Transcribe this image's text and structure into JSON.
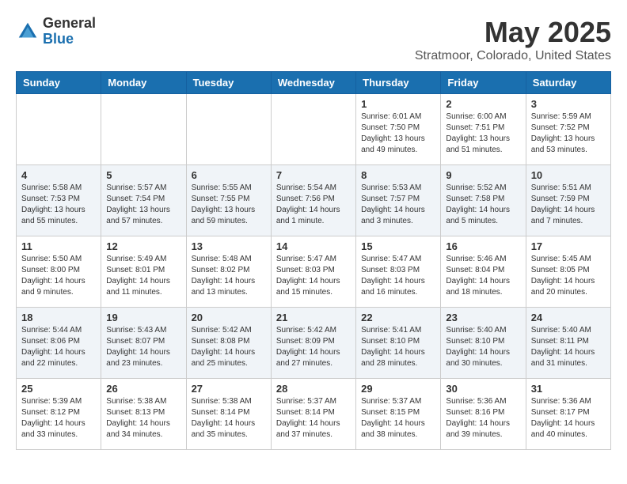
{
  "header": {
    "logo_general": "General",
    "logo_blue": "Blue",
    "month_title": "May 2025",
    "location": "Stratmoor, Colorado, United States"
  },
  "weekdays": [
    "Sunday",
    "Monday",
    "Tuesday",
    "Wednesday",
    "Thursday",
    "Friday",
    "Saturday"
  ],
  "weeks": [
    [
      {
        "day": "",
        "info": ""
      },
      {
        "day": "",
        "info": ""
      },
      {
        "day": "",
        "info": ""
      },
      {
        "day": "",
        "info": ""
      },
      {
        "day": "1",
        "info": "Sunrise: 6:01 AM\nSunset: 7:50 PM\nDaylight: 13 hours\nand 49 minutes."
      },
      {
        "day": "2",
        "info": "Sunrise: 6:00 AM\nSunset: 7:51 PM\nDaylight: 13 hours\nand 51 minutes."
      },
      {
        "day": "3",
        "info": "Sunrise: 5:59 AM\nSunset: 7:52 PM\nDaylight: 13 hours\nand 53 minutes."
      }
    ],
    [
      {
        "day": "4",
        "info": "Sunrise: 5:58 AM\nSunset: 7:53 PM\nDaylight: 13 hours\nand 55 minutes."
      },
      {
        "day": "5",
        "info": "Sunrise: 5:57 AM\nSunset: 7:54 PM\nDaylight: 13 hours\nand 57 minutes."
      },
      {
        "day": "6",
        "info": "Sunrise: 5:55 AM\nSunset: 7:55 PM\nDaylight: 13 hours\nand 59 minutes."
      },
      {
        "day": "7",
        "info": "Sunrise: 5:54 AM\nSunset: 7:56 PM\nDaylight: 14 hours\nand 1 minute."
      },
      {
        "day": "8",
        "info": "Sunrise: 5:53 AM\nSunset: 7:57 PM\nDaylight: 14 hours\nand 3 minutes."
      },
      {
        "day": "9",
        "info": "Sunrise: 5:52 AM\nSunset: 7:58 PM\nDaylight: 14 hours\nand 5 minutes."
      },
      {
        "day": "10",
        "info": "Sunrise: 5:51 AM\nSunset: 7:59 PM\nDaylight: 14 hours\nand 7 minutes."
      }
    ],
    [
      {
        "day": "11",
        "info": "Sunrise: 5:50 AM\nSunset: 8:00 PM\nDaylight: 14 hours\nand 9 minutes."
      },
      {
        "day": "12",
        "info": "Sunrise: 5:49 AM\nSunset: 8:01 PM\nDaylight: 14 hours\nand 11 minutes."
      },
      {
        "day": "13",
        "info": "Sunrise: 5:48 AM\nSunset: 8:02 PM\nDaylight: 14 hours\nand 13 minutes."
      },
      {
        "day": "14",
        "info": "Sunrise: 5:47 AM\nSunset: 8:03 PM\nDaylight: 14 hours\nand 15 minutes."
      },
      {
        "day": "15",
        "info": "Sunrise: 5:47 AM\nSunset: 8:03 PM\nDaylight: 14 hours\nand 16 minutes."
      },
      {
        "day": "16",
        "info": "Sunrise: 5:46 AM\nSunset: 8:04 PM\nDaylight: 14 hours\nand 18 minutes."
      },
      {
        "day": "17",
        "info": "Sunrise: 5:45 AM\nSunset: 8:05 PM\nDaylight: 14 hours\nand 20 minutes."
      }
    ],
    [
      {
        "day": "18",
        "info": "Sunrise: 5:44 AM\nSunset: 8:06 PM\nDaylight: 14 hours\nand 22 minutes."
      },
      {
        "day": "19",
        "info": "Sunrise: 5:43 AM\nSunset: 8:07 PM\nDaylight: 14 hours\nand 23 minutes."
      },
      {
        "day": "20",
        "info": "Sunrise: 5:42 AM\nSunset: 8:08 PM\nDaylight: 14 hours\nand 25 minutes."
      },
      {
        "day": "21",
        "info": "Sunrise: 5:42 AM\nSunset: 8:09 PM\nDaylight: 14 hours\nand 27 minutes."
      },
      {
        "day": "22",
        "info": "Sunrise: 5:41 AM\nSunset: 8:10 PM\nDaylight: 14 hours\nand 28 minutes."
      },
      {
        "day": "23",
        "info": "Sunrise: 5:40 AM\nSunset: 8:10 PM\nDaylight: 14 hours\nand 30 minutes."
      },
      {
        "day": "24",
        "info": "Sunrise: 5:40 AM\nSunset: 8:11 PM\nDaylight: 14 hours\nand 31 minutes."
      }
    ],
    [
      {
        "day": "25",
        "info": "Sunrise: 5:39 AM\nSunset: 8:12 PM\nDaylight: 14 hours\nand 33 minutes."
      },
      {
        "day": "26",
        "info": "Sunrise: 5:38 AM\nSunset: 8:13 PM\nDaylight: 14 hours\nand 34 minutes."
      },
      {
        "day": "27",
        "info": "Sunrise: 5:38 AM\nSunset: 8:14 PM\nDaylight: 14 hours\nand 35 minutes."
      },
      {
        "day": "28",
        "info": "Sunrise: 5:37 AM\nSunset: 8:14 PM\nDaylight: 14 hours\nand 37 minutes."
      },
      {
        "day": "29",
        "info": "Sunrise: 5:37 AM\nSunset: 8:15 PM\nDaylight: 14 hours\nand 38 minutes."
      },
      {
        "day": "30",
        "info": "Sunrise: 5:36 AM\nSunset: 8:16 PM\nDaylight: 14 hours\nand 39 minutes."
      },
      {
        "day": "31",
        "info": "Sunrise: 5:36 AM\nSunset: 8:17 PM\nDaylight: 14 hours\nand 40 minutes."
      }
    ]
  ]
}
